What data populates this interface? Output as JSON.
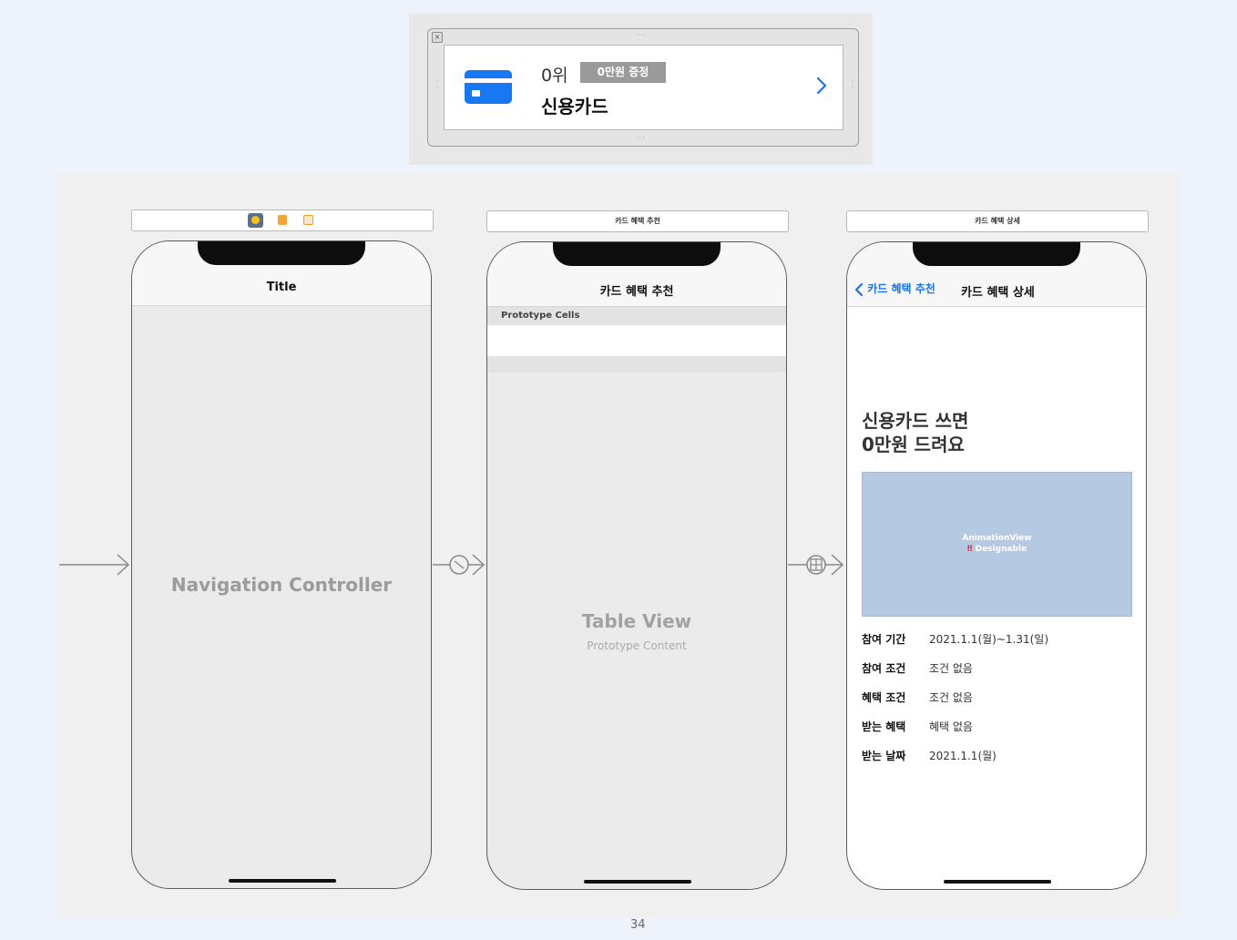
{
  "cell_preview": {
    "rank": "0위",
    "badge": "0만원 증정",
    "name": "신용카드",
    "close_glyph": "×",
    "icons": [
      "credit-card-icon",
      "chevron-right-icon",
      "close-icon"
    ]
  },
  "scenes": {
    "navigation": {
      "nav_title": "Title",
      "label": "Navigation Controller",
      "bar_icons": [
        "view-controller-icon",
        "first-responder-icon",
        "exit-icon"
      ]
    },
    "table": {
      "bar_label": "카드 혜택 추천",
      "nav_title": "카드 혜택 추천",
      "section_header": "Prototype Cells",
      "label": "Table View",
      "sublabel": "Prototype Content"
    },
    "detail": {
      "bar_label": "카드 혜택 상세",
      "back_label": "카드 혜택 추천",
      "nav_title": "카드 혜택 상세",
      "headline_line1": "신용카드 쓰면",
      "headline_line2": "0만원 드려요",
      "animation_view_label": "AnimationView",
      "designable_warning": "‼",
      "designable_label": "Designable",
      "info": [
        {
          "label": "참여 기간",
          "value": "2021.1.1(월)~1.31(일)"
        },
        {
          "label": "참여 조건",
          "value": "조건 없음"
        },
        {
          "label": "혜택 조건",
          "value": "조건 없음"
        },
        {
          "label": "받는 혜택",
          "value": "혜택 없음"
        },
        {
          "label": "받는 날짜",
          "value": "2021.1.1(월)"
        }
      ]
    }
  },
  "colors": {
    "accent": "#1a73f5",
    "card": "#1877f2",
    "badge": "#9a9a9a",
    "animation_view": "#b6c9e3"
  },
  "page_number": "34"
}
